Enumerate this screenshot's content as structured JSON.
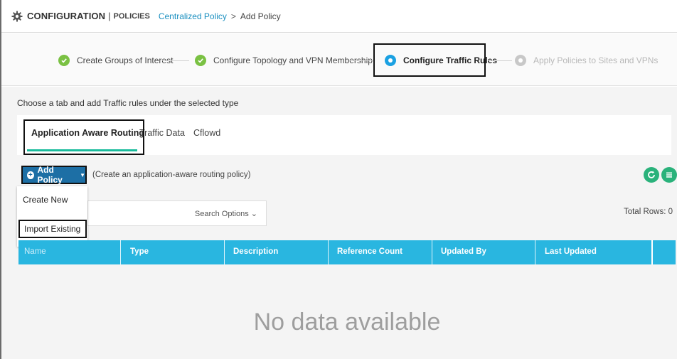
{
  "header": {
    "section": "CONFIGURATION",
    "separator": "|",
    "subsection": "POLICIES",
    "breadcrumb_link": "Centralized Policy",
    "breadcrumb_arrow": ">",
    "breadcrumb_current": "Add Policy",
    "icon": "gear-icon"
  },
  "steps": [
    {
      "label": "Create Groups of Interest",
      "state": "done"
    },
    {
      "label": "Configure Topology and VPN Membership",
      "state": "done"
    },
    {
      "label": "Configure Traffic Rules",
      "state": "active"
    },
    {
      "label": "Apply Policies to Sites and VPNs",
      "state": "todo"
    }
  ],
  "instructions": "Choose a tab and add Traffic rules under the selected type",
  "tabs": [
    {
      "label": "Application Aware Routing",
      "active": true
    },
    {
      "label": "Traffic Data",
      "active": false
    },
    {
      "label": "Cflowd",
      "active": false
    }
  ],
  "toolbar": {
    "add_policy_label": "Add Policy",
    "add_policy_hint": "(Create an application-aware routing policy)",
    "refresh_icon": "refresh-icon",
    "menu_icon": "list-icon"
  },
  "dropdown": {
    "items": [
      "Create New",
      "Import Existing"
    ]
  },
  "search": {
    "options_label": "Search Options",
    "total_rows": "Total Rows: 0"
  },
  "table": {
    "columns": [
      "Name",
      "Type",
      "Description",
      "Reference Count",
      "Updated By",
      "Last Updated"
    ],
    "empty_text": "No data available"
  },
  "colors": {
    "accent": "#29b6e0",
    "primary_button": "#1d6fa5",
    "success": "#7ac143",
    "active_step": "#1ba1e2",
    "tab_underline": "#1abc9c",
    "icon_button": "#2ab27b"
  }
}
